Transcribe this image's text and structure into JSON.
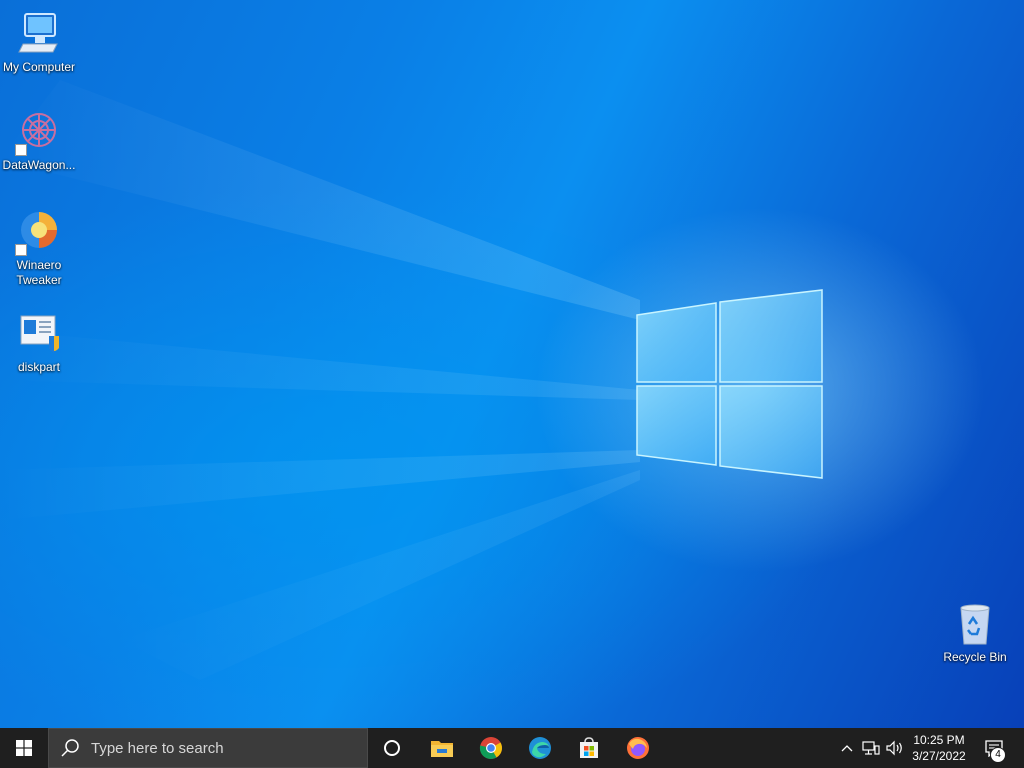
{
  "desktop": {
    "icons": [
      {
        "label": "My Computer",
        "icon": "computer-icon"
      },
      {
        "label": "DataWagon...",
        "icon": "datawagon-icon"
      },
      {
        "label": "Winaero\nTweaker",
        "icon": "winaero-tweaker-icon"
      },
      {
        "label": "diskpart",
        "icon": "diskpart-icon"
      },
      {
        "label": "Recycle Bin",
        "icon": "recycle-bin-icon"
      }
    ]
  },
  "taskbar": {
    "search_placeholder": "Type here to search",
    "apps": [
      {
        "name": "Cortana",
        "icon": "cortana-icon"
      },
      {
        "name": "File Explorer",
        "icon": "file-explorer-icon"
      },
      {
        "name": "Google Chrome",
        "icon": "chrome-icon"
      },
      {
        "name": "Microsoft Edge",
        "icon": "edge-icon"
      },
      {
        "name": "Microsoft Store",
        "icon": "store-icon"
      },
      {
        "name": "Firefox",
        "icon": "firefox-icon"
      }
    ],
    "tray": {
      "time": "10:25 PM",
      "date": "3/27/2022",
      "notification_count": "4"
    }
  },
  "colors": {
    "taskbar_bg": "#1f1f1f",
    "search_bg": "#3b3b3b",
    "accent": "#0078d7"
  }
}
